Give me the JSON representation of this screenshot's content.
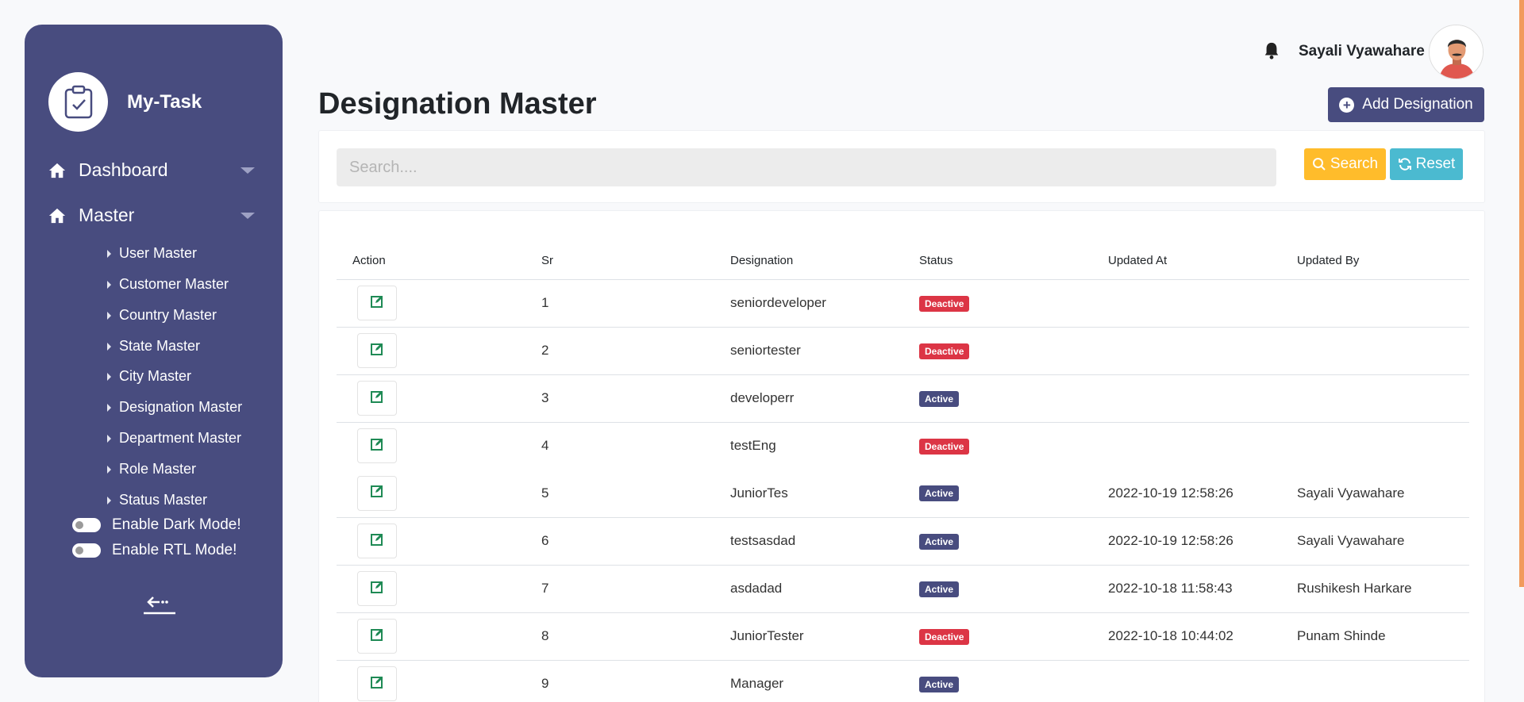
{
  "app": {
    "name": "My-Task"
  },
  "sidebar": {
    "main": [
      {
        "label": "Dashboard"
      },
      {
        "label": "Master"
      }
    ],
    "submenu": [
      "User Master",
      "Customer Master",
      "Country Master",
      "State Master",
      "City Master",
      "Designation Master",
      "Department Master",
      "Role Master",
      "Status Master"
    ],
    "toggles": {
      "dark_mode": "Enable Dark Mode!",
      "rtl_mode": "Enable RTL Mode!"
    }
  },
  "header": {
    "user_name": "Sayali Vyawahare"
  },
  "page": {
    "title": "Designation Master",
    "add_button": "Add Designation"
  },
  "search": {
    "placeholder": "Search....",
    "value": "",
    "search_label": "Search",
    "reset_label": "Reset"
  },
  "table": {
    "headers": [
      "Action",
      "Sr",
      "Designation",
      "Status",
      "Updated At",
      "Updated By"
    ],
    "rows": [
      {
        "sr": "1",
        "designation": "seniordeveloper",
        "status": "Deactive",
        "updated_at": "",
        "updated_by": ""
      },
      {
        "sr": "2",
        "designation": "seniortester",
        "status": "Deactive",
        "updated_at": "",
        "updated_by": ""
      },
      {
        "sr": "3",
        "designation": "developerr",
        "status": "Active",
        "updated_at": "",
        "updated_by": ""
      },
      {
        "sr": "4",
        "designation": "testEng",
        "status": "Deactive",
        "updated_at": "",
        "updated_by": ""
      },
      {
        "sr": "5",
        "designation": "JuniorTes",
        "status": "Active",
        "updated_at": "2022-10-19 12:58:26",
        "updated_by": "Sayali Vyawahare"
      },
      {
        "sr": "6",
        "designation": "testsasdad",
        "status": "Active",
        "updated_at": "2022-10-19 12:58:26",
        "updated_by": "Sayali Vyawahare"
      },
      {
        "sr": "7",
        "designation": "asdadad",
        "status": "Active",
        "updated_at": "2022-10-18 11:58:43",
        "updated_by": "Rushikesh Harkare"
      },
      {
        "sr": "8",
        "designation": "JuniorTester",
        "status": "Deactive",
        "updated_at": "2022-10-18 10:44:02",
        "updated_by": "Punam Shinde"
      },
      {
        "sr": "9",
        "designation": "Manager",
        "status": "Active",
        "updated_at": "",
        "updated_by": ""
      }
    ]
  },
  "colors": {
    "sidebar": "#484c7f",
    "active_badge": "#484c7f",
    "deactive_badge": "#dc3545",
    "search_button": "#ffbc2b",
    "reset_button": "#4bbad0",
    "edit_icon": "#1f8a55"
  },
  "icons": [
    "clipboard-check-icon",
    "home-icon",
    "bell-icon",
    "plus-circle-icon",
    "search-icon",
    "refresh-icon",
    "edit-icon",
    "collapse-icon"
  ]
}
